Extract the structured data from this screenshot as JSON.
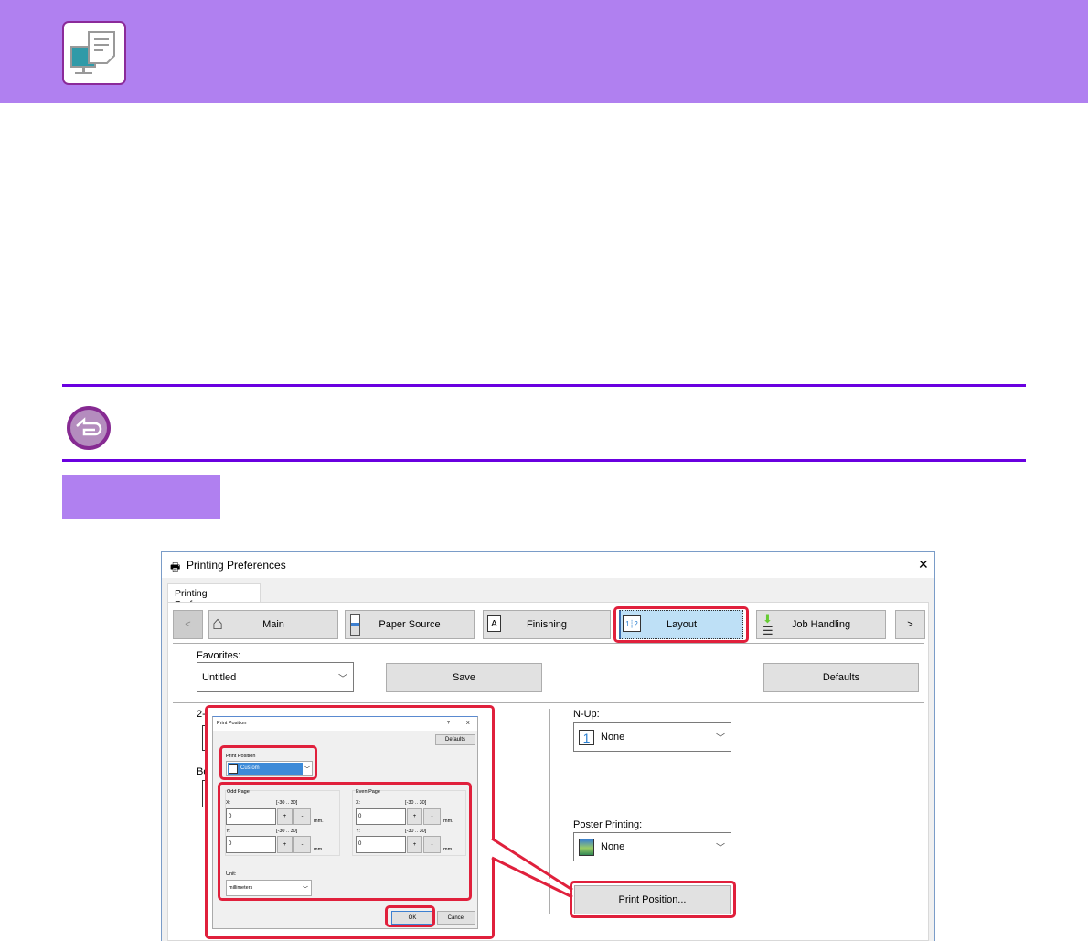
{
  "header": {
    "icon": "printer-driver-icon",
    "color": "#b080f0"
  },
  "note": {
    "icon": "return-arrow-icon"
  },
  "window": {
    "title": "Printing Preferences",
    "tab": "Printing Preferences",
    "nav": {
      "prev": "<",
      "next": ">",
      "items": [
        {
          "label": "Main",
          "icon": "home-icon"
        },
        {
          "label": "Paper Source",
          "icon": "printer-paper-icon"
        },
        {
          "label": "Finishing",
          "icon": "staple-page-icon"
        },
        {
          "label": "Layout",
          "icon": "two-page-layout-icon",
          "selected": true
        },
        {
          "label": "Job Handling",
          "icon": "storage-icon"
        }
      ]
    },
    "favorites_label": "Favorites:",
    "favorites_value": "Untitled",
    "save": "Save",
    "defaults": "Defaults",
    "left_partial_1": "2-",
    "left_partial_2": "Bo",
    "nup_label": "N-Up:",
    "nup_value": "None",
    "nup_icon_text": "1",
    "poster_label": "Poster Printing:",
    "poster_value": "None",
    "print_position_button": "Print Position..."
  },
  "dialog": {
    "title": "Print Position",
    "help": "?",
    "close": "X",
    "defaults": "Defaults",
    "pp_label": "Print Position",
    "pp_value": "Custom",
    "odd": {
      "title": "Odd Page",
      "x_label": "X:",
      "y_label": "Y:",
      "range": "[-30 .. 30]",
      "x": "0",
      "y": "0"
    },
    "even": {
      "title": "Even Page",
      "x_label": "X:",
      "y_label": "Y:",
      "range": "[-30 .. 30]",
      "x": "0",
      "y": "0"
    },
    "plus": "+",
    "minus": "-",
    "unit_suffix": "mm.",
    "unit_label": "Unit:",
    "unit_value": "millimeters",
    "ok": "OK",
    "cancel": "Cancel"
  },
  "colors": {
    "highlight": "#e0203c",
    "rule": "#6a00e0",
    "selected_tab": "#bee0f6"
  }
}
